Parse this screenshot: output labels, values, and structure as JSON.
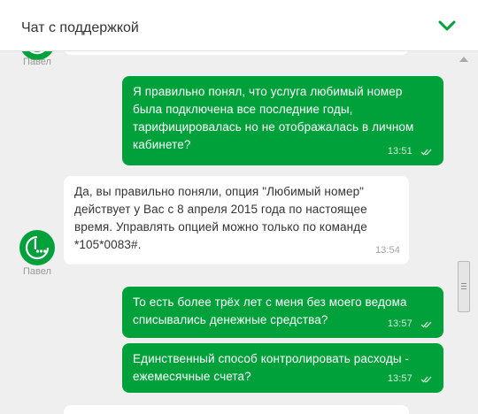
{
  "header": {
    "title": "Чат с поддержкой"
  },
  "agent": {
    "name": "Павел"
  },
  "messages": [
    {
      "direction": "outgoing",
      "text": "Я правильно понял, что услуга любимый номер\nбыла подключена все последние годы,\nтарифицировалась но не отображалась в личном\nкабинете?",
      "time": "13:51",
      "status": "delivered"
    },
    {
      "direction": "incoming",
      "author": "Павел",
      "text": "Да, вы правильно поняли, опция \"Любимый номер\"\nдействует у Вас с 8 апреля 2015 года по настоящее\nвремя. Управлять опцией можно только по команде\n*105*0083#.",
      "time": "13:54"
    },
    {
      "direction": "outgoing",
      "text": "То есть более трёх лет с меня без моего ведома\nсписывались денежные средства?",
      "time": "13:57",
      "status": "delivered"
    },
    {
      "direction": "outgoing",
      "text": "Единственный способ контролировать расходы -\nежемесячные счета?",
      "time": "13:57",
      "status": "delivered"
    }
  ],
  "colors": {
    "accent": "#00a13a",
    "background": "#efefef",
    "incoming_bubble": "#ffffff",
    "outgoing_text": "#ffffff"
  },
  "icons": {
    "collapse": "chevron-down-icon",
    "avatar": "operator-logo-icon",
    "read_receipt": "double-check-icon",
    "scroll_up": "arrow-up-icon"
  }
}
